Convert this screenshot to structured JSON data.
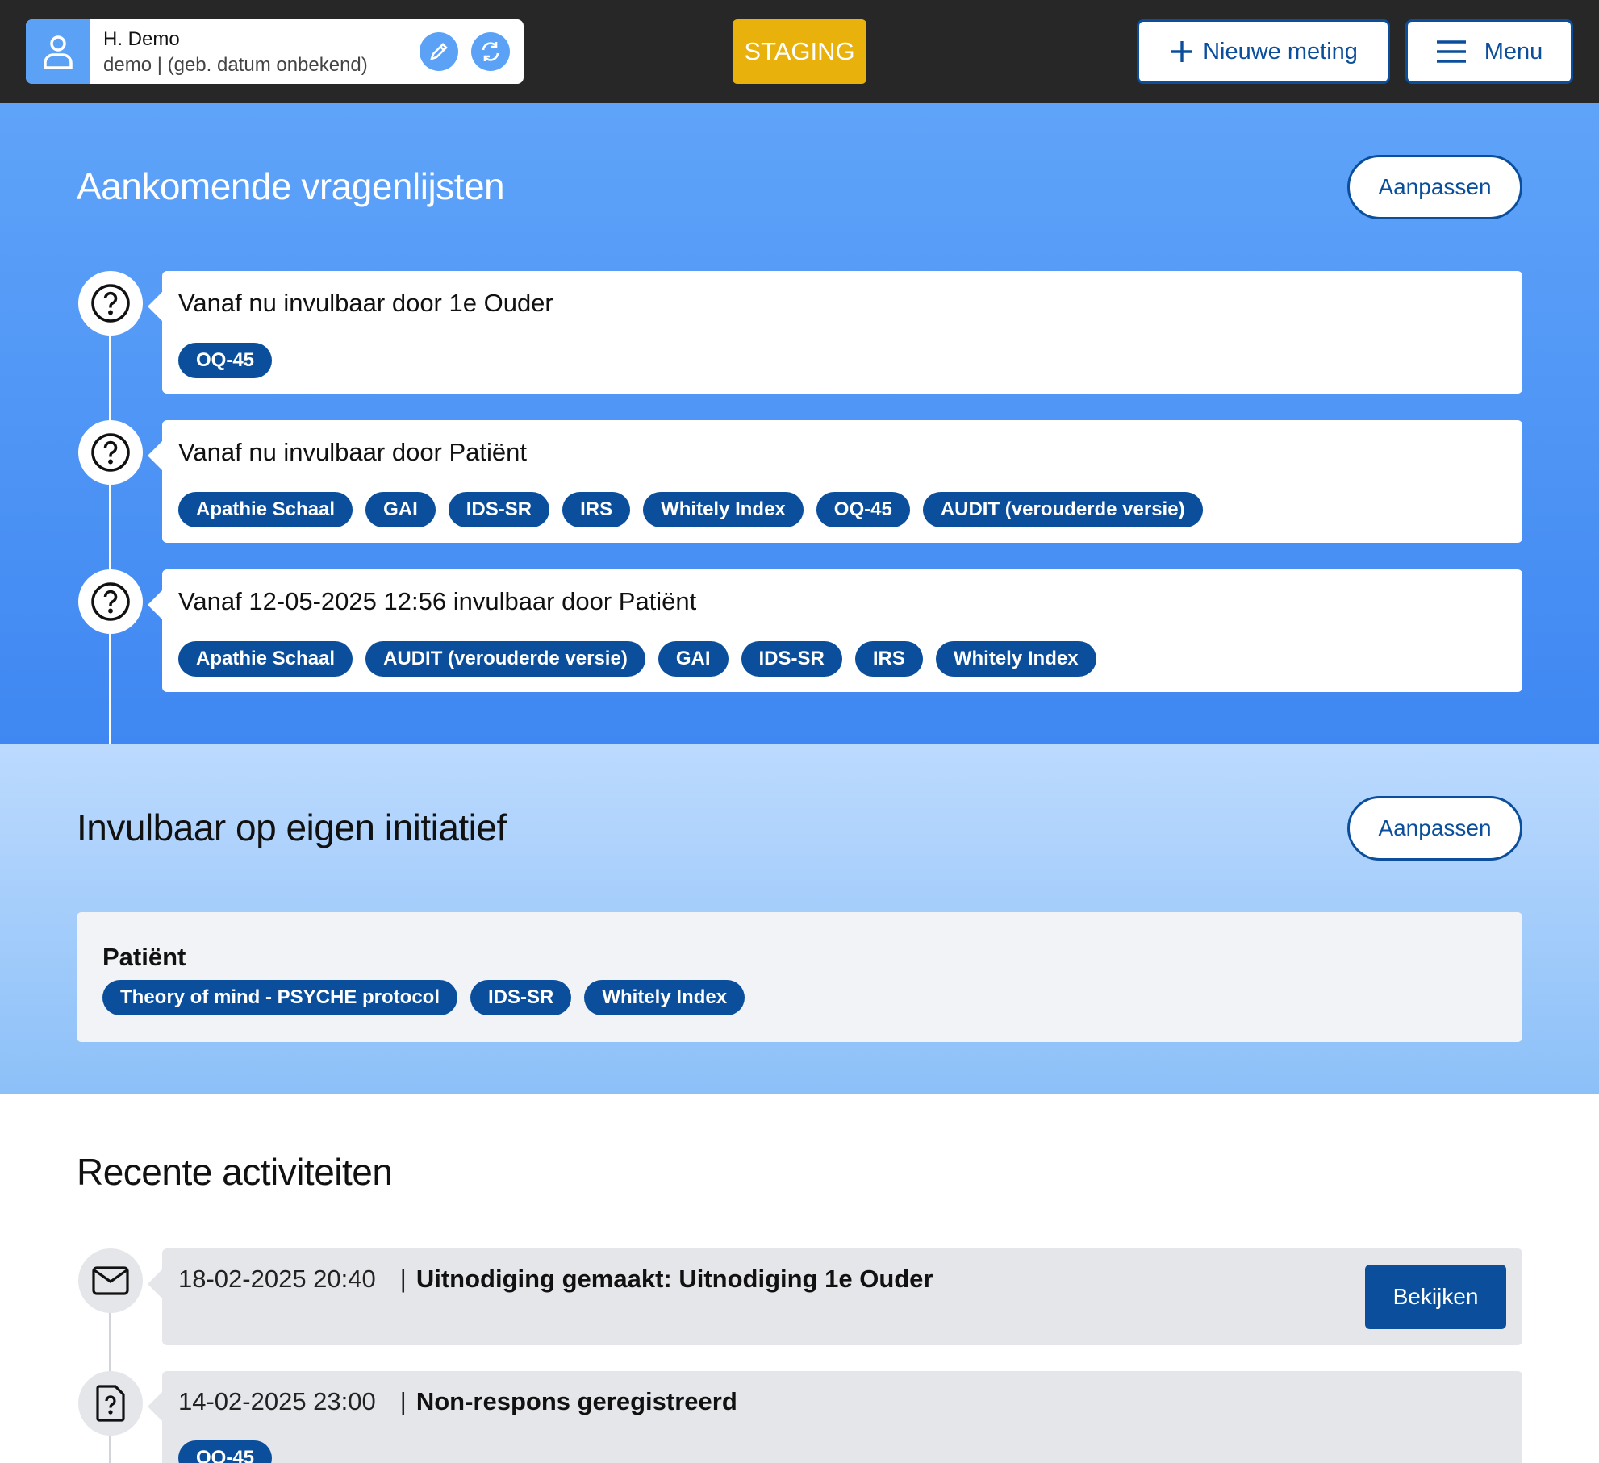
{
  "header": {
    "patient_name": "H. Demo",
    "patient_sub": "demo | (geb. datum onbekend)",
    "staging_label": "STAGING",
    "new_measurement_label": "Nieuwe meting",
    "menu_label": "Menu"
  },
  "upcoming": {
    "title": "Aankomende vragenlijsten",
    "edit_label": "Aanpassen",
    "items": [
      {
        "title": "Vanaf nu invulbaar door 1e Ouder",
        "tags": [
          "OQ-45"
        ]
      },
      {
        "title": "Vanaf nu invulbaar door Patiënt",
        "tags": [
          "Apathie Schaal",
          "GAI",
          "IDS-SR",
          "IRS",
          "Whitely Index",
          "OQ-45",
          "AUDIT (verouderde versie)"
        ]
      },
      {
        "title": "Vanaf 12-05-2025 12:56 invulbaar door Patiënt",
        "tags": [
          "Apathie Schaal",
          "AUDIT (verouderde versie)",
          "GAI",
          "IDS-SR",
          "IRS",
          "Whitely Index"
        ]
      }
    ]
  },
  "own_initiative": {
    "title": "Invulbaar op eigen initiatief",
    "edit_label": "Aanpassen",
    "group_title": "Patiënt",
    "tags": [
      "Theory of mind - PSYCHE protocol",
      "IDS-SR",
      "Whitely Index"
    ]
  },
  "recent": {
    "title": "Recente activiteiten",
    "items": [
      {
        "date": "18-02-2025 20:40",
        "text": "Uitnodiging gemaakt: Uitnodiging 1e Ouder",
        "button": "Bekijken",
        "icon": "mail-icon"
      },
      {
        "date": "14-02-2025 23:00",
        "text": "Non-respons geregistreerd",
        "tags": [
          "OQ-45"
        ],
        "icon": "file-question-icon"
      }
    ]
  },
  "colors": {
    "topbar": "#272727",
    "accent": "#0b4f9c",
    "staging": "#e8b10c",
    "section_blue": "#4a90f5",
    "section_light": "#a9cffc"
  }
}
